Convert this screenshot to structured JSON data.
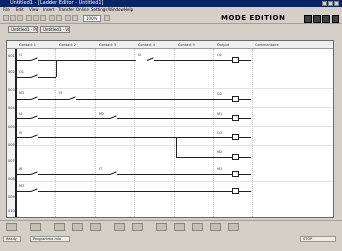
{
  "window": {
    "title": "Untitled1 - [Ladder Editor - Untitled1]"
  },
  "menu": [
    "File",
    "Edit",
    "View",
    "Insert",
    "Transfer",
    "Online",
    "Settings",
    "Window",
    "Help"
  ],
  "toolbar": {
    "zoom_value": "100%",
    "mode_label": "MODE EDITION"
  },
  "tabs": [
    "Untitled1 - Program",
    "Untitled1 - Variables"
  ],
  "ladder": {
    "columns": [
      "Contact 1",
      "Contact 2",
      "Contact 3",
      "Contact 4",
      "Contact 5",
      "Output",
      "Commentaire"
    ],
    "row_numbers": [
      "001",
      "002",
      "003",
      "004",
      "005",
      "006",
      "007",
      "008",
      "009",
      "010"
    ],
    "contact_labels": [
      "I1",
      "I2",
      "Q1",
      "M1",
      "I3",
      "I4",
      "M2",
      "I5",
      "I6",
      "I7",
      "M3"
    ],
    "coil_labels": [
      "Q1",
      "Q2",
      "M1",
      "Q3",
      "M2",
      "M3"
    ]
  },
  "status": {
    "left": "Ready",
    "mid": "Programme.mla",
    "right": "STOP"
  }
}
